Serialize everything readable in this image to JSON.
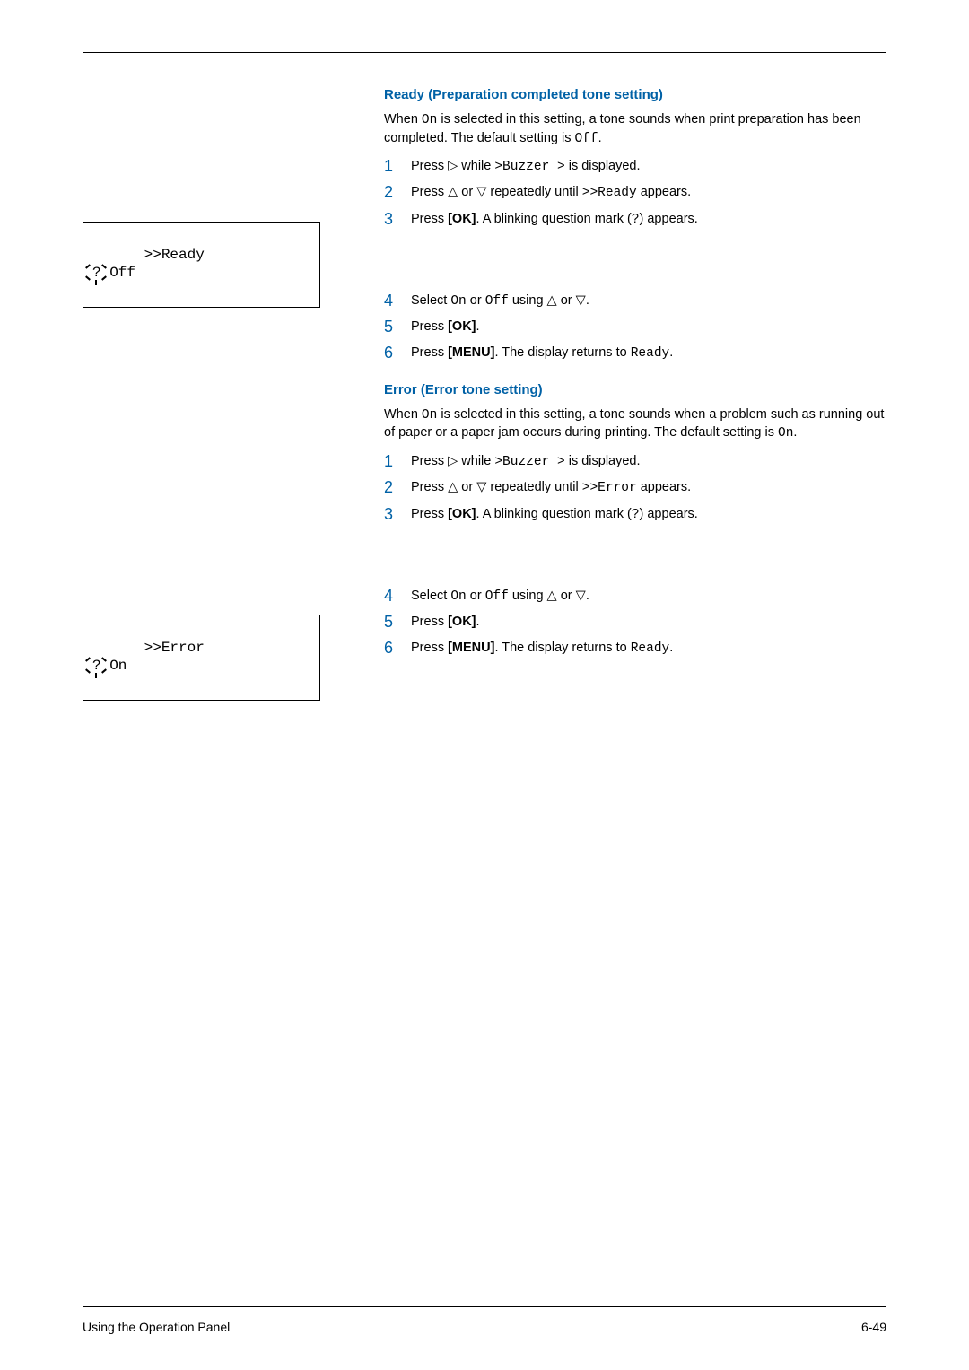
{
  "section1": {
    "title": "Ready (Preparation completed tone setting)",
    "intro_a": "When ",
    "intro_mono1": "On",
    "intro_b": " is selected in this setting, a tone sounds when print preparation has been completed. The default setting is ",
    "intro_mono2": "Off",
    "intro_c": ".",
    "s1_a": "Press ",
    "s1_b": " while ",
    "s1_mono": ">Buzzer >",
    "s1_c": " is displayed.",
    "s2_a": "Press ",
    "s2_b": " or ",
    "s2_c": " repeatedly until ",
    "s2_mono": ">>Ready",
    "s2_d": " appears.",
    "s3_a": "Press ",
    "s3_bold": "[OK]",
    "s3_b": ". A blinking question mark (",
    "s3_mono": "?",
    "s3_c": ") appears.",
    "s4_a": "Select ",
    "s4_mono1": "On",
    "s4_b": " or ",
    "s4_mono2": "Off",
    "s4_c": " using ",
    "s4_d": " or ",
    "s4_e": ".",
    "s5_a": "Press ",
    "s5_bold": "[OK]",
    "s5_b": ".",
    "s6_a": "Press ",
    "s6_bold": "[MENU]",
    "s6_b": ". The display returns to ",
    "s6_mono": "Ready",
    "s6_c": "."
  },
  "disp1": {
    "line1": ">>Ready",
    "line2a": "? ",
    "line2b": "Off"
  },
  "section2": {
    "title": "Error (Error tone setting)",
    "intro_a": "When ",
    "intro_mono1": "On",
    "intro_b": " is selected in this setting, a tone sounds when a problem such as running out of paper or a paper jam occurs during printing. The default setting is ",
    "intro_mono2": "On",
    "intro_c": ".",
    "s1_a": "Press ",
    "s1_b": " while ",
    "s1_mono": ">Buzzer >",
    "s1_c": " is displayed.",
    "s2_a": "Press ",
    "s2_b": " or ",
    "s2_c": " repeatedly until ",
    "s2_mono": ">>Error",
    "s2_d": " appears.",
    "s3_a": "Press ",
    "s3_bold": "[OK]",
    "s3_b": ". A blinking question mark (",
    "s3_mono": "?",
    "s3_c": ") appears.",
    "s4_a": "Select ",
    "s4_mono1": "On",
    "s4_b": " or ",
    "s4_mono2": "Off",
    "s4_c": " using ",
    "s4_d": " or ",
    "s4_e": ".",
    "s5_a": "Press ",
    "s5_bold": "[OK]",
    "s5_b": ".",
    "s6_a": "Press ",
    "s6_bold": "[MENU]",
    "s6_b": ". The display returns to ",
    "s6_mono": "Ready",
    "s6_c": "."
  },
  "disp2": {
    "line1": ">>Error",
    "line2a": "? ",
    "line2b": "On"
  },
  "glyph": {
    "right": "▷",
    "up": "△",
    "down": "▽"
  },
  "footer": {
    "left": "Using the Operation Panel",
    "right": "6-49"
  }
}
